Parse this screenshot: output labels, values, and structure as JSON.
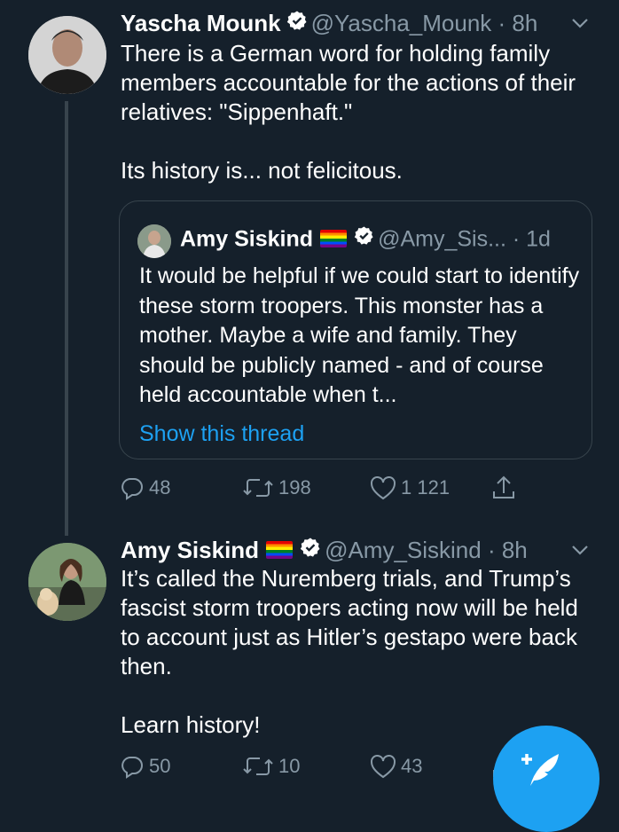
{
  "tweets": [
    {
      "name": "Yascha Mounk",
      "handle": "@Yascha_Mounk",
      "dot": " · ",
      "time": "8h",
      "text": "There is a German word for holding family members accountable for the actions of their relatives: \"Sippenhaft.\"\n\nIts history is... not felicitous.",
      "quoted": {
        "name": "Amy Siskind",
        "handle": "@Amy_Sis...",
        "dot": " · ",
        "time": "1d",
        "text": "It would be helpful if we could start to identify these storm troopers.  This monster has a mother. Maybe a wife and family.  They should be publicly named - and of course held accountable when t...",
        "show_thread": "Show this thread"
      },
      "replies": "48",
      "retweets": "198",
      "likes": "1 121"
    },
    {
      "name": "Amy Siskind",
      "handle": "@Amy_Siskind",
      "dot": " · ",
      "time": "8h",
      "text": "It’s called the Nuremberg trials, and Trump’s fascist storm troopers acting now will be held to account just as Hitler’s gestapo were back then.\n\nLearn history!",
      "replies": "50",
      "retweets": "10",
      "likes": "43"
    }
  ],
  "colors": {
    "background": "#15202b",
    "secondary_text": "#8899a6",
    "accent": "#1da1f2",
    "border": "#38444d"
  },
  "icons": [
    "verified-badge-icon",
    "pride-flag-icon",
    "chevron-down-icon",
    "reply-icon",
    "retweet-icon",
    "like-icon",
    "share-icon",
    "compose-tweet-icon"
  ]
}
